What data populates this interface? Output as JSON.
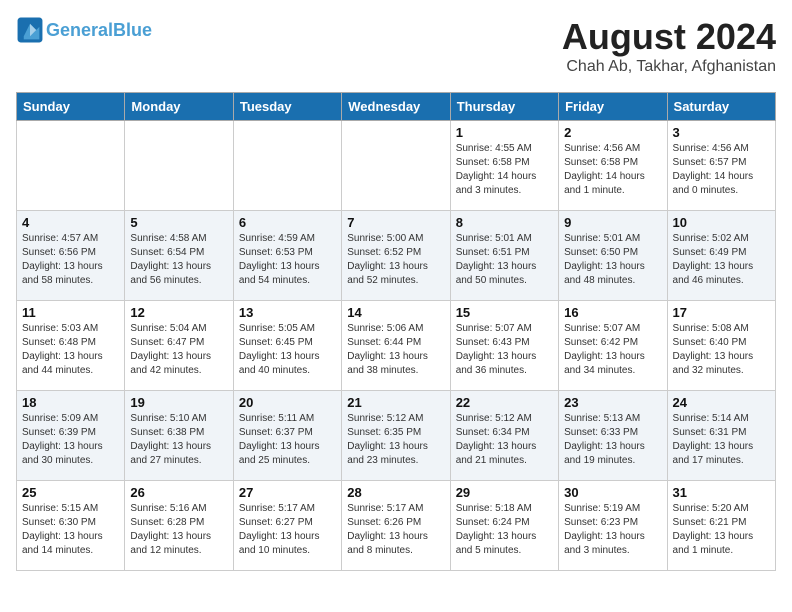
{
  "logo": {
    "line1": "General",
    "line2": "Blue"
  },
  "title": {
    "month_year": "August 2024",
    "location": "Chah Ab, Takhar, Afghanistan"
  },
  "days_of_week": [
    "Sunday",
    "Monday",
    "Tuesday",
    "Wednesday",
    "Thursday",
    "Friday",
    "Saturday"
  ],
  "weeks": [
    [
      {
        "day": "",
        "info": ""
      },
      {
        "day": "",
        "info": ""
      },
      {
        "day": "",
        "info": ""
      },
      {
        "day": "",
        "info": ""
      },
      {
        "day": "1",
        "info": "Sunrise: 4:55 AM\nSunset: 6:58 PM\nDaylight: 14 hours\nand 3 minutes."
      },
      {
        "day": "2",
        "info": "Sunrise: 4:56 AM\nSunset: 6:58 PM\nDaylight: 14 hours\nand 1 minute."
      },
      {
        "day": "3",
        "info": "Sunrise: 4:56 AM\nSunset: 6:57 PM\nDaylight: 14 hours\nand 0 minutes."
      }
    ],
    [
      {
        "day": "4",
        "info": "Sunrise: 4:57 AM\nSunset: 6:56 PM\nDaylight: 13 hours\nand 58 minutes."
      },
      {
        "day": "5",
        "info": "Sunrise: 4:58 AM\nSunset: 6:54 PM\nDaylight: 13 hours\nand 56 minutes."
      },
      {
        "day": "6",
        "info": "Sunrise: 4:59 AM\nSunset: 6:53 PM\nDaylight: 13 hours\nand 54 minutes."
      },
      {
        "day": "7",
        "info": "Sunrise: 5:00 AM\nSunset: 6:52 PM\nDaylight: 13 hours\nand 52 minutes."
      },
      {
        "day": "8",
        "info": "Sunrise: 5:01 AM\nSunset: 6:51 PM\nDaylight: 13 hours\nand 50 minutes."
      },
      {
        "day": "9",
        "info": "Sunrise: 5:01 AM\nSunset: 6:50 PM\nDaylight: 13 hours\nand 48 minutes."
      },
      {
        "day": "10",
        "info": "Sunrise: 5:02 AM\nSunset: 6:49 PM\nDaylight: 13 hours\nand 46 minutes."
      }
    ],
    [
      {
        "day": "11",
        "info": "Sunrise: 5:03 AM\nSunset: 6:48 PM\nDaylight: 13 hours\nand 44 minutes."
      },
      {
        "day": "12",
        "info": "Sunrise: 5:04 AM\nSunset: 6:47 PM\nDaylight: 13 hours\nand 42 minutes."
      },
      {
        "day": "13",
        "info": "Sunrise: 5:05 AM\nSunset: 6:45 PM\nDaylight: 13 hours\nand 40 minutes."
      },
      {
        "day": "14",
        "info": "Sunrise: 5:06 AM\nSunset: 6:44 PM\nDaylight: 13 hours\nand 38 minutes."
      },
      {
        "day": "15",
        "info": "Sunrise: 5:07 AM\nSunset: 6:43 PM\nDaylight: 13 hours\nand 36 minutes."
      },
      {
        "day": "16",
        "info": "Sunrise: 5:07 AM\nSunset: 6:42 PM\nDaylight: 13 hours\nand 34 minutes."
      },
      {
        "day": "17",
        "info": "Sunrise: 5:08 AM\nSunset: 6:40 PM\nDaylight: 13 hours\nand 32 minutes."
      }
    ],
    [
      {
        "day": "18",
        "info": "Sunrise: 5:09 AM\nSunset: 6:39 PM\nDaylight: 13 hours\nand 30 minutes."
      },
      {
        "day": "19",
        "info": "Sunrise: 5:10 AM\nSunset: 6:38 PM\nDaylight: 13 hours\nand 27 minutes."
      },
      {
        "day": "20",
        "info": "Sunrise: 5:11 AM\nSunset: 6:37 PM\nDaylight: 13 hours\nand 25 minutes."
      },
      {
        "day": "21",
        "info": "Sunrise: 5:12 AM\nSunset: 6:35 PM\nDaylight: 13 hours\nand 23 minutes."
      },
      {
        "day": "22",
        "info": "Sunrise: 5:12 AM\nSunset: 6:34 PM\nDaylight: 13 hours\nand 21 minutes."
      },
      {
        "day": "23",
        "info": "Sunrise: 5:13 AM\nSunset: 6:33 PM\nDaylight: 13 hours\nand 19 minutes."
      },
      {
        "day": "24",
        "info": "Sunrise: 5:14 AM\nSunset: 6:31 PM\nDaylight: 13 hours\nand 17 minutes."
      }
    ],
    [
      {
        "day": "25",
        "info": "Sunrise: 5:15 AM\nSunset: 6:30 PM\nDaylight: 13 hours\nand 14 minutes."
      },
      {
        "day": "26",
        "info": "Sunrise: 5:16 AM\nSunset: 6:28 PM\nDaylight: 13 hours\nand 12 minutes."
      },
      {
        "day": "27",
        "info": "Sunrise: 5:17 AM\nSunset: 6:27 PM\nDaylight: 13 hours\nand 10 minutes."
      },
      {
        "day": "28",
        "info": "Sunrise: 5:17 AM\nSunset: 6:26 PM\nDaylight: 13 hours\nand 8 minutes."
      },
      {
        "day": "29",
        "info": "Sunrise: 5:18 AM\nSunset: 6:24 PM\nDaylight: 13 hours\nand 5 minutes."
      },
      {
        "day": "30",
        "info": "Sunrise: 5:19 AM\nSunset: 6:23 PM\nDaylight: 13 hours\nand 3 minutes."
      },
      {
        "day": "31",
        "info": "Sunrise: 5:20 AM\nSunset: 6:21 PM\nDaylight: 13 hours\nand 1 minute."
      }
    ]
  ]
}
